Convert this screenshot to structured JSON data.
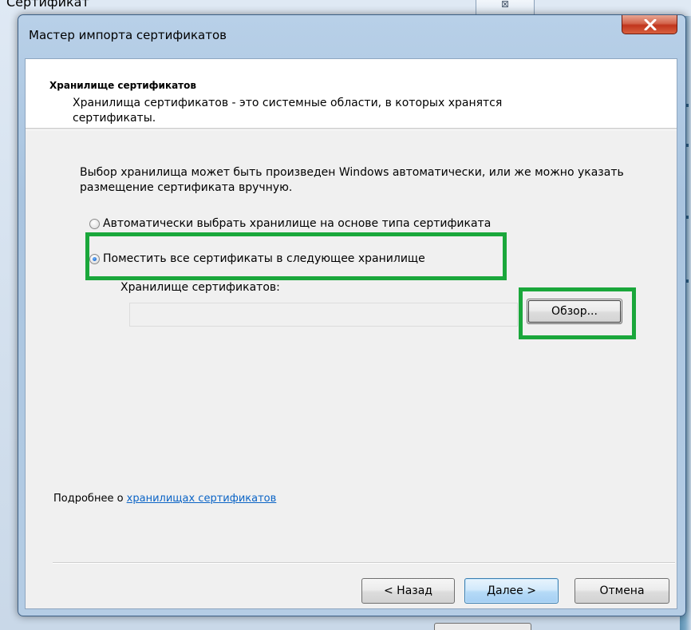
{
  "background_window": {
    "title": "Сертификат",
    "close_glyph": "⊠"
  },
  "dialog": {
    "title": "Мастер импорта сертификатов",
    "close_icon": "close-icon"
  },
  "header": {
    "title": "Хранилище сертификатов",
    "description": "Хранилища сертификатов - это системные области, в которых хранятся сертификаты."
  },
  "body": {
    "intro": "Выбор хранилища может быть произведен Windows автоматически, или же можно указать размещение сертификата вручную.",
    "options": [
      {
        "label": "Автоматически выбрать хранилище на основе типа сертификата",
        "selected": false
      },
      {
        "label": "Поместить все сертификаты в следующее хранилище",
        "selected": true
      }
    ],
    "store_label": "Хранилище сертификатов:",
    "store_value": "",
    "browse_label": "Обзор..."
  },
  "more_info": {
    "prefix": "Подробнее о ",
    "link_text": "хранилищах сертификатов"
  },
  "footer": {
    "back_label": "< Назад",
    "next_label": "Далее >",
    "cancel_label": "Отмена"
  },
  "colors": {
    "highlight": "#1aa73b",
    "link": "#0b64c6",
    "close_button": "#c1351d"
  }
}
